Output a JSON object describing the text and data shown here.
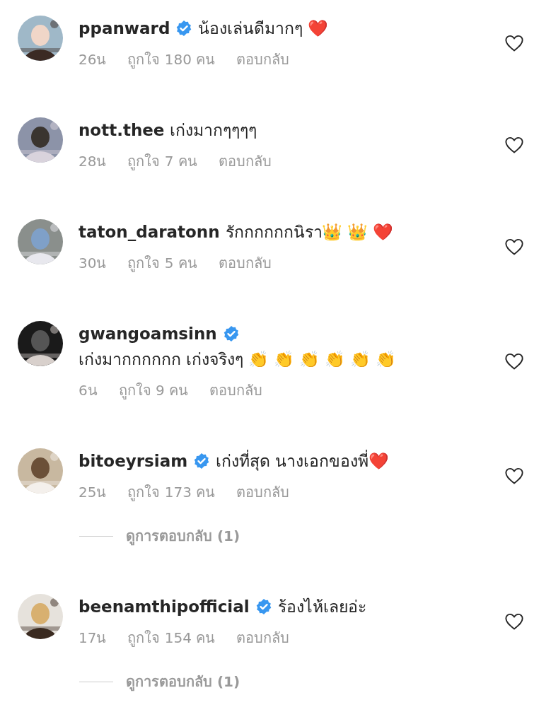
{
  "comments": [
    {
      "username": "ppanward",
      "verified": true,
      "text": "น้องเล่นดีมากๆ ❤️",
      "time": "26น",
      "likes": "ถูกใจ 180 คน",
      "reply": "ตอบกลับ",
      "liked": false
    },
    {
      "username": "nott.thee",
      "verified": false,
      "text": "เก่งมากๆๆๆๆ",
      "time": "28น",
      "likes": "ถูกใจ 7 คน",
      "reply": "ตอบกลับ",
      "liked": false
    },
    {
      "username": "taton_daratonn",
      "verified": false,
      "text": "รักกกกกกนิรา👑 👑 ❤️",
      "time": "30น",
      "likes": "ถูกใจ 5 คน",
      "reply": "ตอบกลับ",
      "liked": false
    },
    {
      "username": "gwangoamsinn",
      "verified": true,
      "text": "เก่งมากกกกกก เก่งจริงๆ 👏 👏 👏 👏 👏 👏",
      "time": "6น",
      "likes": "ถูกใจ 9 คน",
      "reply": "ตอบกลับ",
      "liked": false
    },
    {
      "username": "bitoeyrsiam",
      "verified": true,
      "text": "เก่งที่สุด นางเอกของพี่❤️",
      "time": "25น",
      "likes": "ถูกใจ 173 คน",
      "reply": "ตอบกลับ",
      "liked": false,
      "view_replies": "ดูการตอบกลับ (1)"
    },
    {
      "username": "beenamthipofficial",
      "verified": true,
      "text": "ร้องไห้เลยอ่ะ",
      "time": "17น",
      "likes": "ถูกใจ 154 คน",
      "reply": "ตอบกลับ",
      "liked": false,
      "view_replies": "ดูการตอบกลับ (1)"
    }
  ]
}
